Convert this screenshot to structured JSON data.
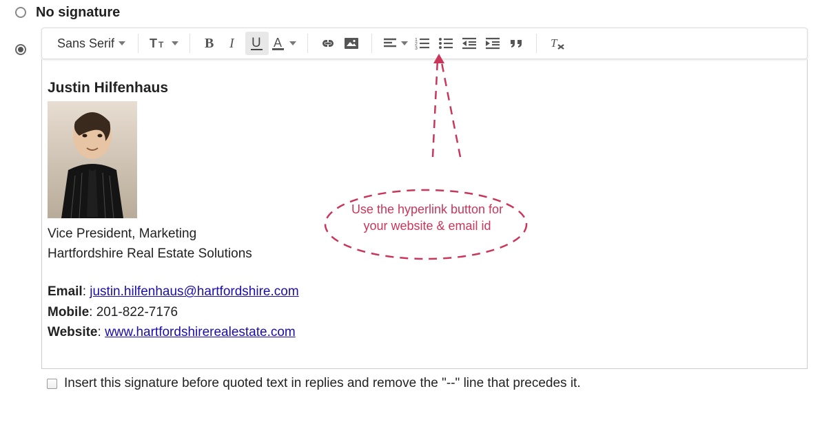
{
  "options": {
    "no_signature_label": "No signature"
  },
  "toolbar": {
    "font_family": "Sans Serif"
  },
  "signature": {
    "name": "Justin Hilfenhaus",
    "title": "Vice President, Marketing",
    "company": "Hartfordshire Real Estate Solutions",
    "email_label": "Email",
    "email_value": "justin.hilfenhaus@hartfordshire.com",
    "mobile_label": "Mobile",
    "mobile_value": "201-822-7176",
    "website_label": "Website",
    "website_value": "www.hartfordshirerealestate.com",
    "colon_space": ": "
  },
  "footer": {
    "insert_before_quoted": "Insert this signature before quoted text in replies and remove the \"--\" line that precedes it."
  },
  "annotation": {
    "text": "Use the hyperlink button for your website & email id"
  }
}
